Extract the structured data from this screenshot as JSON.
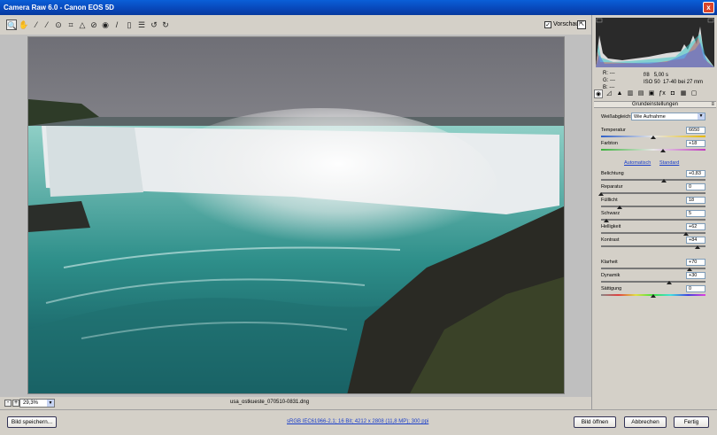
{
  "window": {
    "title": "Camera Raw 6.0 - Canon EOS 5D",
    "close_label": "x"
  },
  "toolbar": {
    "tools": [
      "zoom-icon",
      "hand-icon",
      "white-balance-icon",
      "color-sampler-icon",
      "target-adjust-icon",
      "crop-icon",
      "straighten-icon",
      "spot-removal-icon",
      "red-eye-icon",
      "adjustment-brush-icon",
      "graduated-filter-icon",
      "preferences-icon",
      "rotate-ccw-icon",
      "rotate-cw-icon"
    ],
    "preview_label": "Vorschau",
    "preview_checked": "✓"
  },
  "bottom": {
    "zoom_minus": "-",
    "zoom_plus": "+",
    "zoom_value": "29,3%",
    "filename": "usa_ostkueste_070510-0831.dng"
  },
  "readout": {
    "r_label": "R:",
    "g_label": "G:",
    "b_label": "B:",
    "r_val": "---",
    "g_val": "---",
    "b_val": "---",
    "aperture": "f/8",
    "shutter": "5,00 s",
    "iso": "ISO 50",
    "lens": "17-40 bei 27 mm"
  },
  "panel": {
    "section_title": "Grundeinstellungen",
    "wb_label": "Weißabgleich:",
    "wb_value": "Wie Aufnahme",
    "auto_link": "Automatisch",
    "standard_link": "Standard",
    "sliders": [
      {
        "label": "Temperatur",
        "value": "6650",
        "pos": 0.5
      },
      {
        "label": "Farbton",
        "value": "+18",
        "pos": 0.59
      },
      {
        "label": "Belichtung",
        "value": "+0,83",
        "pos": 0.6
      },
      {
        "label": "Reparatur",
        "value": "0",
        "pos": 0.0
      },
      {
        "label": "Fülllicht",
        "value": "18",
        "pos": 0.18
      },
      {
        "label": "Schwarz",
        "value": "5",
        "pos": 0.05
      },
      {
        "label": "Helligkeit",
        "value": "+62",
        "pos": 0.81
      },
      {
        "label": "Kontrast",
        "value": "+84",
        "pos": 0.92
      },
      {
        "label": "Klarheit",
        "value": "+70",
        "pos": 0.85
      },
      {
        "label": "Dynamik",
        "value": "+30",
        "pos": 0.65
      },
      {
        "label": "Sättigung",
        "value": "0",
        "pos": 0.5
      }
    ]
  },
  "footer": {
    "save_label": "Bild speichern...",
    "meta_link": "sRGB IEC61966-2.1; 16 Bit; 4212 x 2808 (11,8 MP); 300 ppi",
    "open_label": "Bild öffnen",
    "cancel_label": "Abbrechen",
    "done_label": "Fertig"
  }
}
